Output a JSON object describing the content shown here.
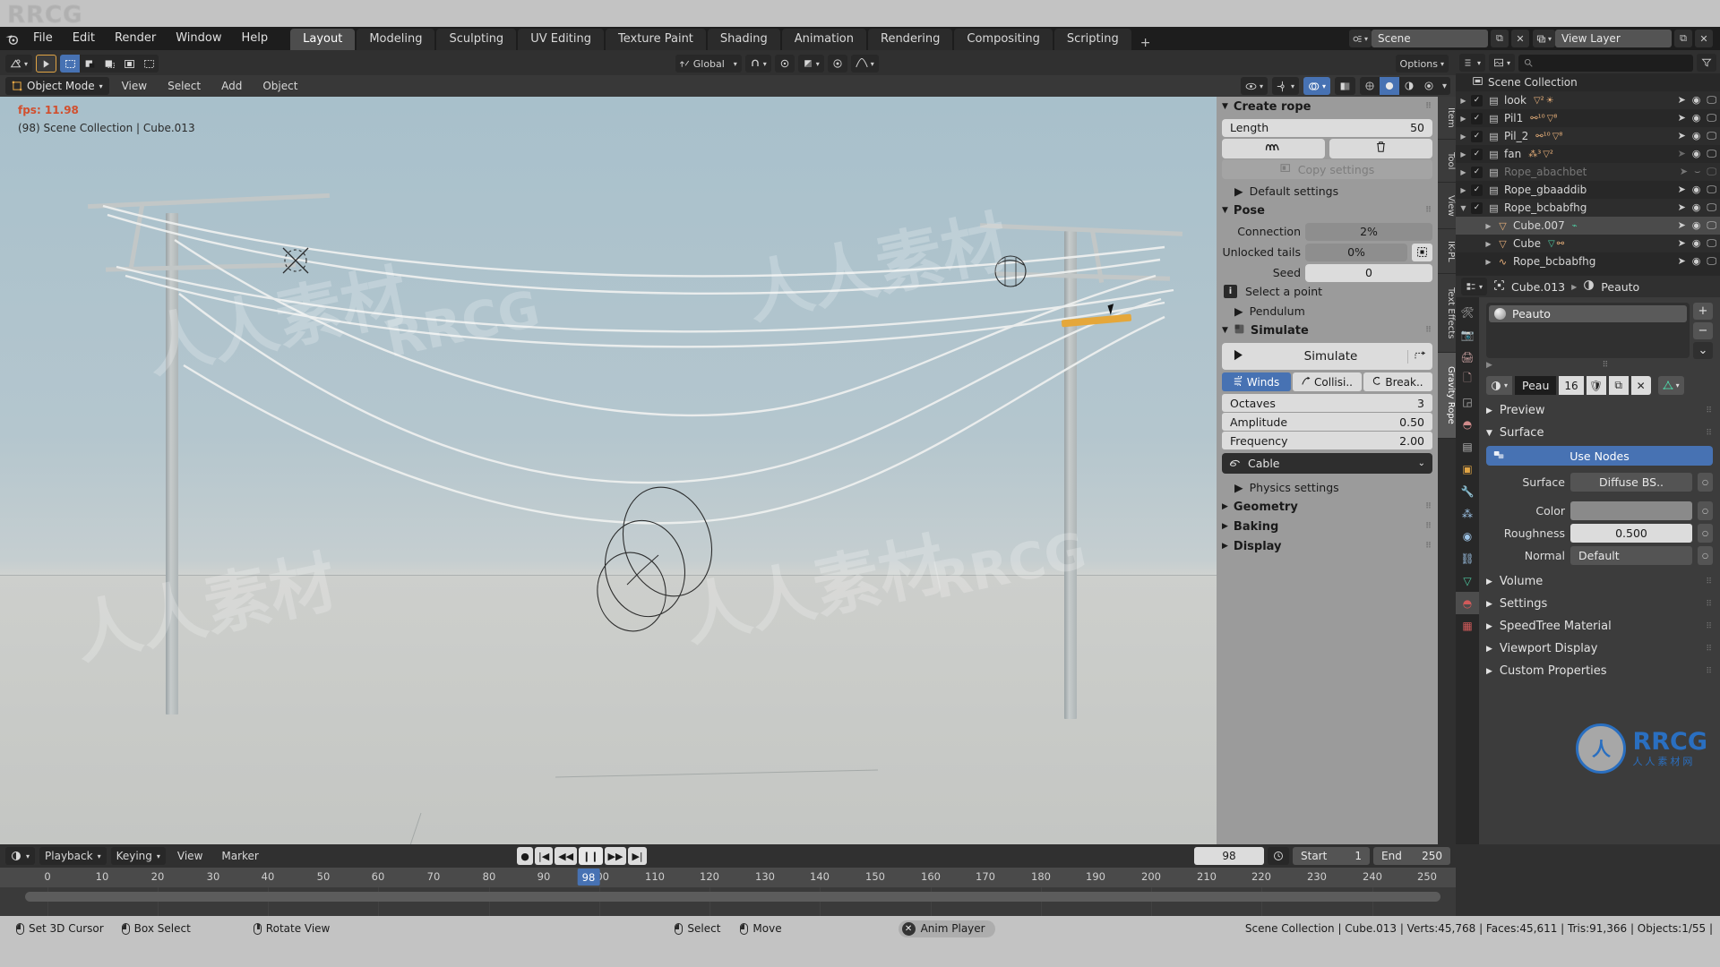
{
  "app": {
    "watermark_text": "RRCG",
    "watermark_cn": "人人素材",
    "logo_sub": "人人素材网"
  },
  "topbar": {
    "logo_icon": "blender-logo",
    "menus": [
      "File",
      "Edit",
      "Render",
      "Window",
      "Help"
    ],
    "workspaces": [
      "Layout",
      "Modeling",
      "Sculpting",
      "UV Editing",
      "Texture Paint",
      "Shading",
      "Animation",
      "Rendering",
      "Compositing",
      "Scripting"
    ],
    "active_workspace": "Layout",
    "add_workspace": "+",
    "scene_label": "Scene",
    "viewlayer_label": "View Layer",
    "scene_icon": "scene-icon",
    "viewlayer_icon": "viewlayer-icon",
    "new_icon": "new-icon",
    "unlink_icon": "unlink-icon"
  },
  "viewport_header": {
    "editor_type_icon": "editor-type-icon",
    "cursor_icon": "cursor-icon",
    "select_modes": [
      "box-select-icon",
      "tweak-icon",
      "lasso-icon",
      "circle-select-icon"
    ],
    "active_select_mode": 0,
    "transform_orientation": "Global",
    "orientation_icon": "orientation-icon",
    "snap_icon": "magnet-icon",
    "proportional_icon": "proportional-icon",
    "pivot_icon": "pivot-icon",
    "falloff_icon": "falloff-icon",
    "options_label": "Options",
    "visibility_icon": "eye-icon",
    "gizmo_icon": "gizmo-icon",
    "overlays_icon": "overlays-icon",
    "xray_icon": "xray-icon",
    "shading_modes": [
      "wireframe-icon",
      "solid-icon",
      "material-preview-icon",
      "rendered-icon"
    ],
    "active_shading": 1
  },
  "mode_row": {
    "mode": "Object Mode",
    "mode_icon": "object-mode-icon",
    "menus": [
      "View",
      "Select",
      "Add",
      "Object"
    ]
  },
  "viewport": {
    "fps": "fps: 11.98",
    "info": "(98) Scene Collection | Cube.013"
  },
  "vertical_tabs": [
    {
      "label": "Item",
      "active": false
    },
    {
      "label": "Tool",
      "active": false
    },
    {
      "label": "View",
      "active": false
    },
    {
      "label": "IK-PL",
      "active": false
    },
    {
      "label": "Text Effects",
      "active": false
    },
    {
      "label": "Gravity Rope",
      "active": true
    }
  ],
  "npanel": {
    "create_rope": {
      "title": "Create rope",
      "length_label": "Length",
      "length_value": "50",
      "create_icon": "rope-icon",
      "delete_icon": "trash-icon",
      "copy_settings_label": "Copy settings",
      "copy_settings_icon": "copy-icon",
      "default_settings_label": "Default settings"
    },
    "pose": {
      "title": "Pose",
      "rows": [
        {
          "label": "Connection",
          "value": "2%"
        },
        {
          "label": "Unlocked tails",
          "value": "0%"
        },
        {
          "label": "Seed",
          "value": "0"
        }
      ],
      "unlocked_tails_icon": "select-point-icon",
      "info_text": "Select a point",
      "info_icon": "info-icon",
      "pendulum_label": "Pendulum"
    },
    "simulate": {
      "title": "Simulate",
      "title_icon": "simulate-icon",
      "button_label": "Simulate",
      "button_play_icon": "play-icon",
      "button_ext_icon": "bake-path-icon",
      "tabs": [
        {
          "label": "Winds",
          "icon": "wind-icon",
          "active": true
        },
        {
          "label": "Collisi..",
          "icon": "collision-icon",
          "active": false
        },
        {
          "label": "Break..",
          "icon": "break-icon",
          "active": false
        }
      ],
      "params": [
        {
          "label": "Octaves",
          "value": "3"
        },
        {
          "label": "Amplitude",
          "value": "0.50"
        },
        {
          "label": "Frequency",
          "value": "2.00"
        }
      ],
      "preset_label": "Cable",
      "preset_icon": "cable-icon",
      "physics_settings_label": "Physics settings"
    },
    "collapsed": [
      {
        "label": "Geometry"
      },
      {
        "label": "Baking"
      },
      {
        "label": "Display"
      }
    ]
  },
  "outliner": {
    "display_mode_icon": "filter-icon",
    "view_layer_icon": "view-layer-icon",
    "search_placeholder": "",
    "search_icon": "search-icon",
    "filter_icon": "funnel-icon",
    "root": "Scene Collection",
    "root_icon": "collection-icon",
    "rows": [
      {
        "name": "look",
        "type": "collection",
        "indent": 0,
        "expanded": false,
        "checked": true,
        "badges": [
          "mesh-2",
          "light"
        ],
        "dim": false,
        "selected": false
      },
      {
        "name": "Pil1",
        "type": "collection",
        "indent": 0,
        "expanded": false,
        "checked": true,
        "badges": [
          "armature-10",
          "mesh-8"
        ],
        "dim": false,
        "selected": false
      },
      {
        "name": "Pil_2",
        "type": "collection",
        "indent": 0,
        "expanded": false,
        "checked": true,
        "badges": [
          "armature-10",
          "mesh-8"
        ],
        "dim": false,
        "selected": false
      },
      {
        "name": "fan",
        "type": "collection",
        "indent": 0,
        "expanded": false,
        "checked": true,
        "badges": [
          "hair-3",
          "mesh-2"
        ],
        "dim": false,
        "selected": false
      },
      {
        "name": "Rope_abachbet",
        "type": "collection",
        "indent": 0,
        "expanded": false,
        "checked": true,
        "badges": [],
        "dim": true,
        "selected": false
      },
      {
        "name": "Rope_gbaaddib",
        "type": "collection",
        "indent": 0,
        "expanded": false,
        "checked": true,
        "badges": [],
        "dim": false,
        "selected": false
      },
      {
        "name": "Rope_bcbabfhg",
        "type": "collection",
        "indent": 0,
        "expanded": true,
        "checked": true,
        "badges": [],
        "dim": false,
        "selected": false
      },
      {
        "name": "Cube.007",
        "type": "mesh",
        "indent": 1,
        "expanded": false,
        "checked": null,
        "badges": [
          "modifier"
        ],
        "dim": false,
        "selected": true
      },
      {
        "name": "Cube",
        "type": "mesh",
        "indent": 1,
        "expanded": false,
        "checked": null,
        "badges": [
          "mesh-data",
          "armature"
        ],
        "dim": false,
        "selected": false
      },
      {
        "name": "Rope_bcbabfhg",
        "type": "curve",
        "indent": 1,
        "expanded": false,
        "checked": null,
        "badges": [],
        "dim": false,
        "selected": false
      }
    ]
  },
  "properties": {
    "breadcrumb_editor_icon": "properties-icon",
    "breadcrumb": [
      {
        "label": "Cube.013",
        "icon": "object-icon"
      },
      {
        "label": "Peauto",
        "icon": "material-icon"
      }
    ],
    "breadcrumb_sep": "▶",
    "tabs": [
      "tool-icon",
      "render-icon",
      "output-icon",
      "viewlayer-icon",
      "scene-icon",
      "world-icon",
      "collection-icon",
      "object-icon",
      "modifier-icon",
      "particles-icon",
      "physics-icon",
      "constraint-icon",
      "data-icon",
      "material-icon",
      "texture-icon"
    ],
    "active_tab": 13,
    "material_slot": "Peauto",
    "slot_add": "+",
    "slot_remove": "−",
    "slot_menu": "⌄",
    "material_name": "Peau",
    "material_users": "16",
    "shield_icon": "fake-user-icon",
    "copy_icon": "new-material-icon",
    "unlink_icon": "unlink-icon",
    "datablock_icon": "material-browse-icon",
    "mesh_icon": "mesh-data-icon",
    "preview_label": "Preview",
    "surface_label": "Surface",
    "use_nodes_label": "Use Nodes",
    "use_nodes_icon": "nodes-icon",
    "surface_rows": [
      {
        "label": "Surface",
        "value": "Diffuse BS..",
        "style": "dark"
      },
      {
        "label": "Color",
        "value": "",
        "style": "swatch"
      },
      {
        "label": "Roughness",
        "value": "0.500",
        "style": "light"
      },
      {
        "label": "Normal",
        "value": "Default",
        "style": "dark"
      }
    ],
    "collapsed_sections": [
      "Volume",
      "Settings",
      "SpeedTree Material",
      "Viewport Display",
      "Custom Properties"
    ]
  },
  "timeline": {
    "editor_icon": "timeline-icon",
    "menus": [
      {
        "label": "Playback",
        "dropdown": true
      },
      {
        "label": "Keying",
        "dropdown": true
      },
      {
        "label": "View",
        "dropdown": false
      },
      {
        "label": "Marker",
        "dropdown": false
      }
    ],
    "playback_buttons": [
      "record-icon",
      "jump-start-icon",
      "prev-keyframe-icon",
      "pause-icon",
      "next-keyframe-icon",
      "jump-end-icon"
    ],
    "current_frame": "98",
    "frame_icon": "frame-icon",
    "start_label": "Start",
    "start_value": "1",
    "end_label": "End",
    "end_value": "250",
    "ticks": [
      0,
      10,
      20,
      30,
      40,
      50,
      60,
      70,
      80,
      90,
      100,
      110,
      120,
      130,
      140,
      150,
      160,
      170,
      180,
      190,
      200,
      210,
      220,
      230,
      240,
      250
    ],
    "playhead_frame": 98,
    "playhead_label": "98"
  },
  "statusbar": {
    "keymap": [
      {
        "label": "Set 3D Cursor",
        "button": "left"
      },
      {
        "label": "Box Select",
        "button": "left-drag"
      },
      {
        "label": "Rotate View",
        "button": "middle"
      },
      {
        "label": "Select",
        "button": "left"
      },
      {
        "label": "Move",
        "button": "left-drag"
      }
    ],
    "anim_player_label": "Anim Player",
    "anim_player_close": "✕",
    "stats": "Scene Collection | Cube.013 | Verts:45,768 | Faces:45,611 | Tris:91,366 | Objects:1/55 |"
  },
  "colors": {
    "accent_blue": "#4772b3",
    "orange": "#e0a444",
    "fps_red": "#d14f2e",
    "panel_grey": "#9b9b9b",
    "dark_bg": "#1d1d1d",
    "logo_blue": "#2a6fc0"
  }
}
